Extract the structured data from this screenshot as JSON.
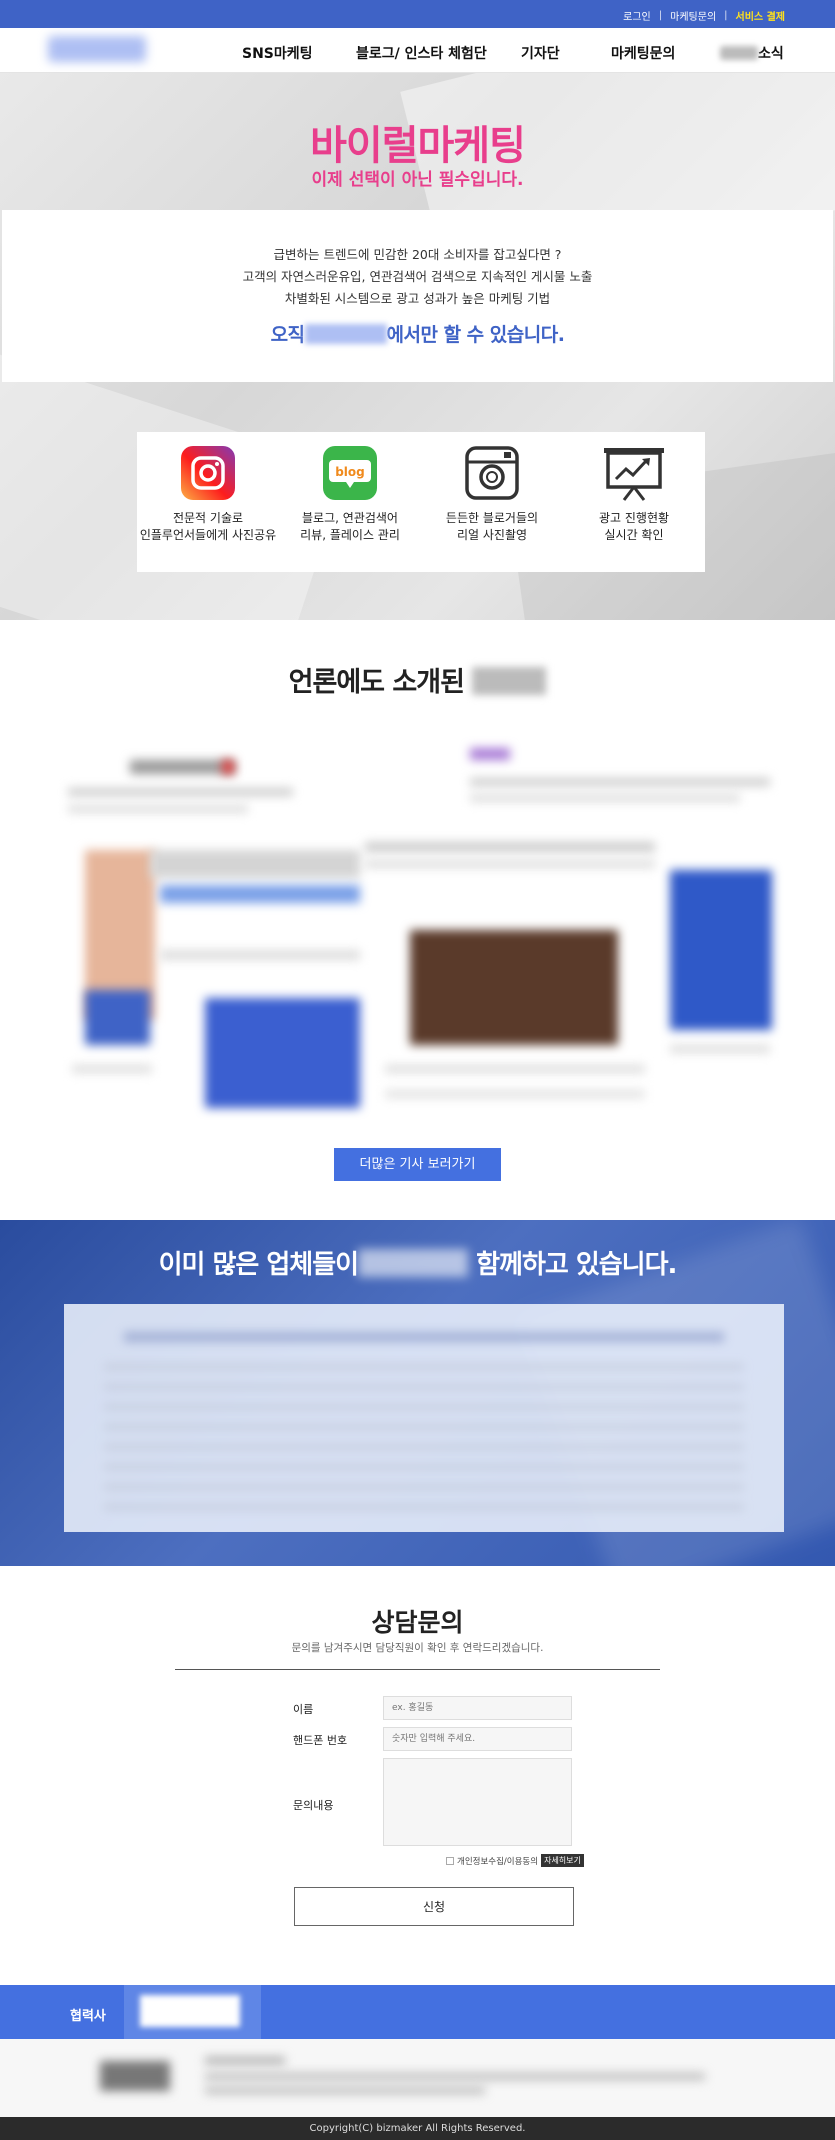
{
  "topbar": {
    "links": [
      "로그인",
      "마케팅문의",
      "서비스 결제"
    ]
  },
  "nav": {
    "items": [
      "SNS마케팅",
      "블로그/ 인스타 체험단",
      "기자단",
      "마케팅문의",
      "소식"
    ]
  },
  "hero": {
    "title": "바이럴마케팅",
    "subtitle": "이제 선택이 아닌 필수입니다.",
    "lines": [
      "급변하는 트렌드에 민감한 20대 소비자를  잡고싶다면 ?",
      "고객의 자연스러운유입, 연관검색어 검색으로 지속적인 게시물 노출",
      "차별화된 시스템으로 광고 성과가  높은 마케팅 기법"
    ],
    "strong_pre": "오직",
    "strong_post": "에서만 할 수 있습니다."
  },
  "features": [
    {
      "icon": "instagram-icon",
      "line1": "전문적 기술로",
      "line2": "인플루언서들에게 사진공유"
    },
    {
      "icon": "blog-icon",
      "line1": "블로그, 연관검색어",
      "line2": "리뷰, 플레이스 관리",
      "badge": "blog"
    },
    {
      "icon": "camera-icon",
      "line1": "든든한 블로거들의",
      "line2": "리얼 사진촬영"
    },
    {
      "icon": "presentation-chart-icon",
      "line1": "광고 진행현황",
      "line2": "실시간 확인"
    }
  ],
  "press": {
    "title": "언론에도 소개된",
    "more_button": "더많은 기사 보러가기"
  },
  "clients": {
    "title_pre": "이미 많은 업체들이",
    "title_post": "함께하고 있습니다."
  },
  "consult": {
    "title": "상담문의",
    "subtitle": "문의를 남겨주시면 담당직원이 확인 후 연락드리겠습니다.",
    "name_label": "이름",
    "name_placeholder": "ex. 홍길동",
    "phone_label": "핸드폰 번호",
    "phone_placeholder": "숫자만 입력해 주세요.",
    "content_label": "문의내용",
    "agree_text": "개인정보수집/이용동의",
    "agree_view": "자세히보기",
    "submit": "신청"
  },
  "partners": {
    "label": "협력사"
  },
  "footer": {
    "copyright": "Copyright(C) bizmaker All Rights Reserved."
  },
  "colors": {
    "brand_blue": "#3f63c6",
    "button_blue": "#4470e0",
    "accent_pink": "#e83e8c",
    "pay_yellow": "#ffe21b"
  }
}
